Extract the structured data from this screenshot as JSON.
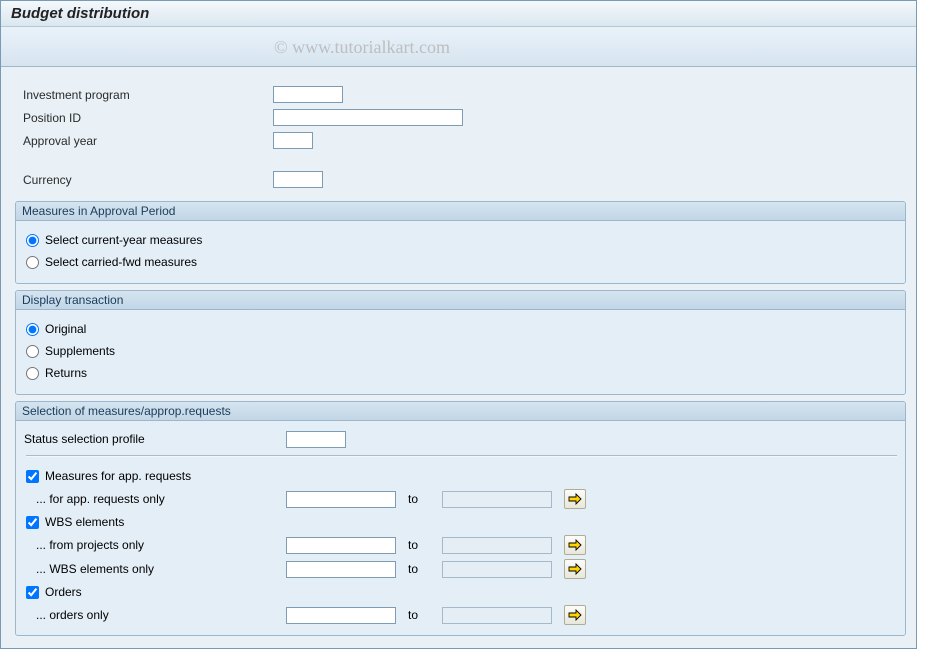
{
  "title": "Budget distribution",
  "watermark": "© www.tutorialkart.com",
  "top": {
    "investment_program_label": "Investment program",
    "position_id_label": "Position ID",
    "approval_year_label": "Approval year",
    "currency_label": "Currency",
    "investment_program_value": "",
    "position_id_value": "",
    "approval_year_value": "",
    "currency_value": ""
  },
  "group_measures": {
    "title": "Measures in Approval Period",
    "opt_current": "Select current-year measures",
    "opt_carried": "Select carried-fwd measures"
  },
  "group_display": {
    "title": "Display transaction",
    "opt_original": "Original",
    "opt_supplements": "Supplements",
    "opt_returns": "Returns"
  },
  "group_selection": {
    "title": "Selection of measures/approp.requests",
    "status_profile_label": "Status selection profile",
    "status_profile_value": "",
    "chk_measures_app": "Measures for app. requests",
    "row_app_only": "... for app. requests only",
    "chk_wbs": "WBS elements",
    "row_projects_only": "... from projects only",
    "row_wbs_only": "... WBS elements only",
    "chk_orders": "Orders",
    "row_orders_only": "... orders only",
    "to": "to"
  }
}
